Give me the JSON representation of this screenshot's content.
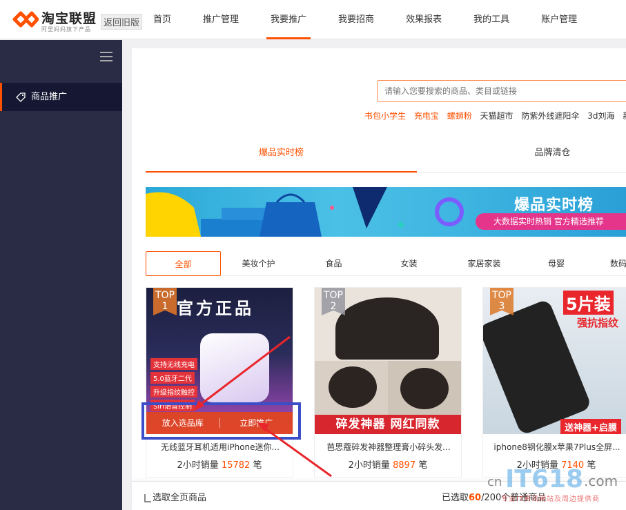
{
  "brand": {
    "title": "淘宝联盟",
    "subtitle": "阿里妈妈旗下产品",
    "back_old": "返回旧版",
    "accent": "#ff5000"
  },
  "nav": {
    "items": [
      {
        "label": "首页"
      },
      {
        "label": "推广管理"
      },
      {
        "label": "我要推广",
        "active": true
      },
      {
        "label": "我要招商"
      },
      {
        "label": "效果报表"
      },
      {
        "label": "我的工具"
      },
      {
        "label": "账户管理"
      }
    ]
  },
  "sidebar": {
    "menu_icon": "hamburger-icon",
    "items": [
      {
        "label": "商品推广",
        "icon": "tag-icon",
        "active": true
      }
    ]
  },
  "search": {
    "placeholder": "请输入您要搜索的商品、类目或链接",
    "hot_words": [
      {
        "label": "书包小学生",
        "hot": true
      },
      {
        "label": "充电宝",
        "hot": true
      },
      {
        "label": "螺蛳粉",
        "hot": true
      },
      {
        "label": "天猫超市",
        "hot": false
      },
      {
        "label": "防紫外线遮阳伞",
        "hot": false
      },
      {
        "label": "3d刘海",
        "hot": false
      },
      {
        "label": "新款",
        "hot": false
      }
    ]
  },
  "tabs": [
    {
      "label": "爆品实时榜",
      "active": true
    },
    {
      "label": "品牌清仓",
      "active": false
    }
  ],
  "banner": {
    "title": "爆品实时榜",
    "subtitle": "大数据实时热销 官方精选推荐"
  },
  "categories": [
    {
      "label": "全部",
      "active": true
    },
    {
      "label": "美妆个护"
    },
    {
      "label": "食品"
    },
    {
      "label": "女装"
    },
    {
      "label": "家居家装"
    },
    {
      "label": "母婴"
    },
    {
      "label": "数码"
    }
  ],
  "products": [
    {
      "rank": "TOP 1",
      "image_text": "官方正品",
      "features": [
        "支持无线充电",
        "5.0蓝牙二代",
        "升级指纹触控",
        "Siri语音控制"
      ],
      "name": "无线蓝牙耳机适用iPhone迷你...",
      "sales_prefix": "2小时销量",
      "sales": "15782",
      "sales_suffix": "笔",
      "actions": {
        "add": "放入选品库",
        "promote": "立即推广"
      }
    },
    {
      "rank": "TOP 2",
      "image_text": "碎发神器 网红同款",
      "name": "芭思蔻碎发神器整理膏小碎头发...",
      "sales_prefix": "2小时销量",
      "sales": "8897",
      "sales_suffix": "笔"
    },
    {
      "rank": "TOP 3",
      "image_text": "5片装",
      "image_text2": "强抗指纹",
      "image_text3": "送神器+启膜",
      "name": "iphone8钢化膜x苹果7Plus全屏...",
      "sales_prefix": "2小时销量",
      "sales": "7140",
      "sales_suffix": "笔"
    }
  ],
  "bottom_bar": {
    "select_all": "选取全页商品",
    "selected_prefix": "已选取",
    "selected_count": "60",
    "selected_suffix": "/200个普通商品"
  },
  "watermark": {
    "text": "cnIT618.com",
    "sub": "专业IT资讯网站及周边提供商"
  }
}
